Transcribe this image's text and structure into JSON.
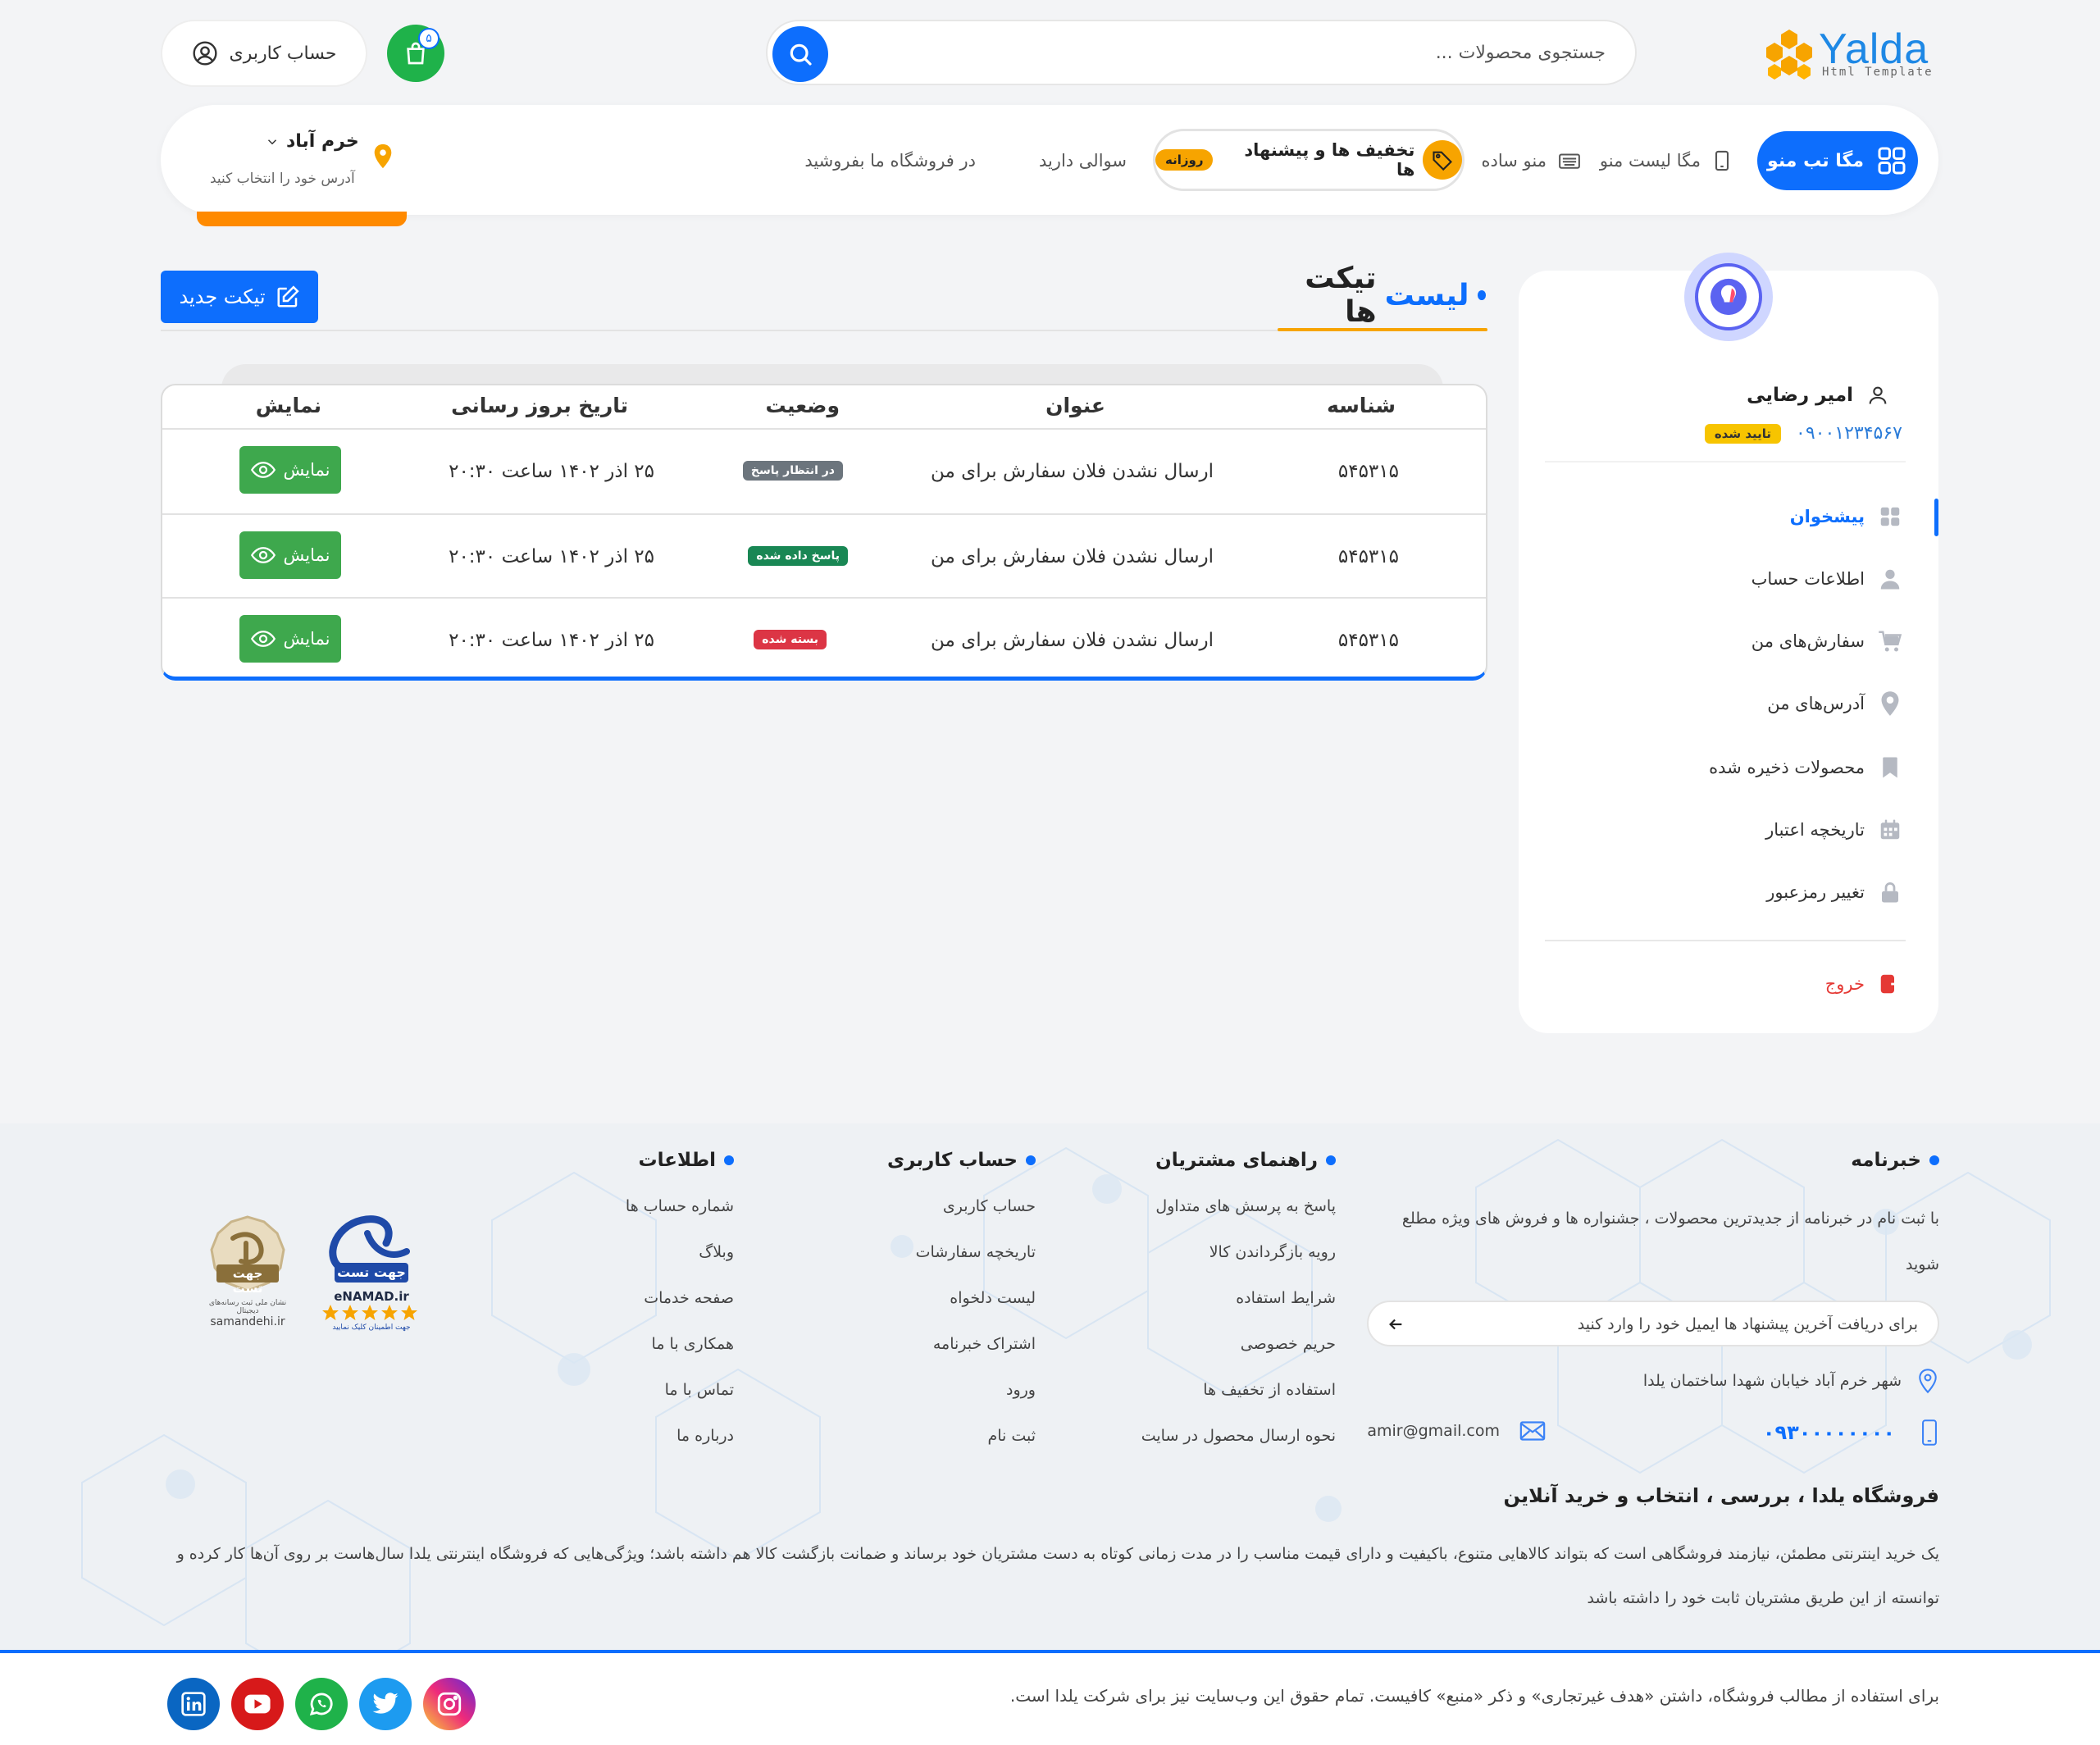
{
  "header": {
    "logo_text": "Yalda",
    "logo_sub": "Html Template",
    "search_placeholder": "جستجوی محصولات ...",
    "cart_count": "۵",
    "account_label": "حساب کاربری"
  },
  "nav": {
    "mega_tab": "مگا تب منو",
    "mega_list": "مگا لیست منو",
    "simple_menu": "منو ساده",
    "discounts": "تخفیف ها و پیشنهاد ها",
    "daily_badge": "روزانه",
    "question": "سوالی دارید",
    "sell": "در فروشگاه ما بفروشید",
    "location_city": "خرم آباد",
    "location_hint": "آدرس خود را انتخاب کنید"
  },
  "sidebar": {
    "user_name": "امیر رضایی",
    "user_phone": "۰۹۰۰۱۲۳۴۵۶۷",
    "verified": "تایید شده",
    "items": [
      {
        "label": "پیشخوان"
      },
      {
        "label": "اطلاعات حساب"
      },
      {
        "label": "سفارش‌های من"
      },
      {
        "label": "آدرس‌های من"
      },
      {
        "label": "محصولات ذخیره شده"
      },
      {
        "label": "تاریخچه اعتبار"
      },
      {
        "label": "تغییر رمزعبور"
      }
    ],
    "logout": "خروج"
  },
  "main": {
    "title_part1": "لیست",
    "title_part2": "تیکت ها",
    "new_ticket": "تیکت جدید",
    "columns": {
      "id": "شناسه",
      "subject": "عنوان",
      "status": "وضعیت",
      "updated": "تاریخ بروز رسانی",
      "view": "نمایش"
    },
    "rows": [
      {
        "id": "۵۴۵۳۱۵",
        "subject": "ارسال نشدن فلان سفارش برای من",
        "status": "در انتظار پاسخ",
        "updated": "۲۵ اذر ۱۴۰۲ ساعت ۲۰:۳۰",
        "view": "نمایش"
      },
      {
        "id": "۵۴۵۳۱۵",
        "subject": "ارسال نشدن فلان سفارش برای من",
        "status": "پاسخ داده شده",
        "updated": "۲۵ اذر ۱۴۰۲ ساعت ۲۰:۳۰",
        "view": "نمایش"
      },
      {
        "id": "۵۴۵۳۱۵",
        "subject": "ارسال نشدن فلان سفارش برای من",
        "status": "بسته شده",
        "updated": "۲۵ اذر ۱۴۰۲ ساعت ۲۰:۳۰",
        "view": "نمایش"
      }
    ],
    "status_colors": {
      "pending": "#6c757d",
      "answered": "#198754",
      "closed": "#dc3545"
    }
  },
  "footer": {
    "newsletter": {
      "title": "خبرنامه",
      "text": "با ثبت نام در خبرنامه از جدیدترین محصولات ، جشنواره ها و فروش های ویژه مطلع شوید",
      "placeholder": "برای دریافت آخرین پیشنهاد ها ایمیل خود را وارد کنید",
      "address": "شهر خرم آباد خیابان شهدا ساختمان یلدا",
      "phone": "۰۹۳۰۰۰۰۰۰۰۰",
      "email": "amir@gmail.com"
    },
    "guide": {
      "title": "راهنمای مشتریان",
      "links": [
        "پاسخ به پرسش های متداول",
        "رویه بازگرداندن کالا",
        "شرایط استفاده",
        "حریم خصوصی",
        "استفاده از تخفیف ها",
        "نحوه ارسال محصول در سایت"
      ]
    },
    "account": {
      "title": "حساب کاربری",
      "links": [
        "حساب کاربری",
        "تاریخچه سفارشات",
        "لیست دلخواه",
        "اشتراک خبرنامه",
        "ورود",
        "ثبت نام"
      ]
    },
    "info": {
      "title": "اطلاعات",
      "links": [
        "شماره حساب ها",
        "وبلاگ",
        "صفحه خدمات",
        "همکاری با ما",
        "تماس با ما",
        "درباره ما"
      ]
    },
    "badges": {
      "enamad_caption": "جهت تست",
      "enamad_label": "eNAMAD.ir",
      "enamad_sub": "جهت اطمینان کلیک نمایید",
      "samandehi_caption": "جهت تست",
      "samandehi_sub": "نشان ملی ثبت رسانه‌های دیجیتال",
      "samandehi_label": "samandehi.ir"
    },
    "about_title": "فروشگاه یلدا ، بررسی ، انتخاب و خرید آنلاین",
    "about_text": "یک خرید اینترنتی مطمئن، نیازمند فروشگاهی است که بتواند کالاهایی متنوع، باکیفیت و دارای قیمت مناسب را در مدت زمانی کوتاه به دست مشتریان خود برساند و ضمانت بازگشت کالا هم داشته باشد؛ ویژگی‌هایی که فروشگاه اینترنتی یلدا سال‌هاست بر روی آن‌ها کار کرده و توانسته از این طریق مشتریان ثابت خود را داشته باشد",
    "copyright": "برای استفاده از مطالب فروشگاه، داشتن «هدف غیرتجاری» و ذکر «منبع» کافیست. تمام حقوق این وب‌سایت نیز برای شرکت یلدا است."
  },
  "colors": {
    "primary": "#0d6efd",
    "accent": "#f7a400",
    "success": "#3ea84d",
    "cart": "#1fb24a"
  }
}
